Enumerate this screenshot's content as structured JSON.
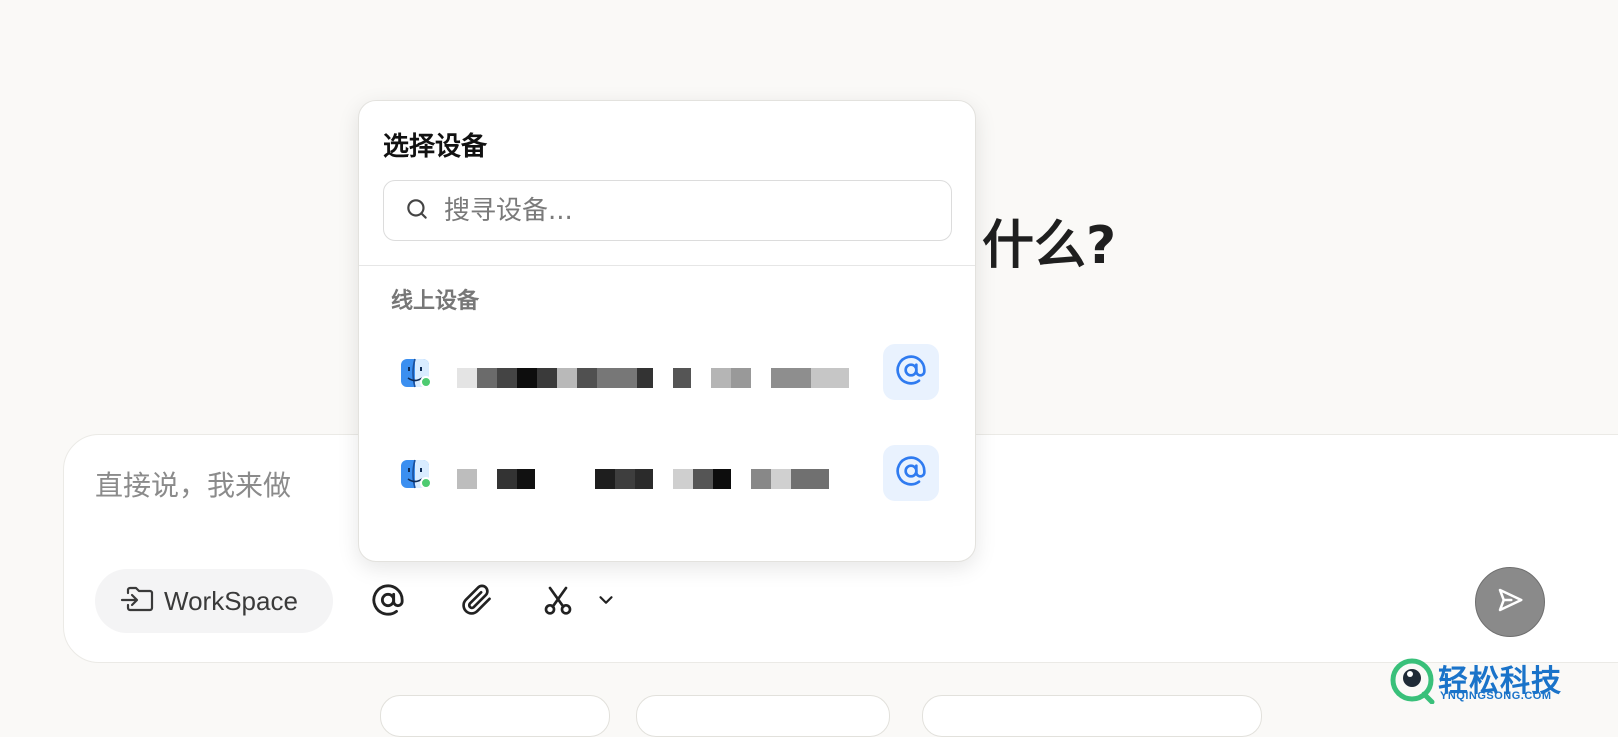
{
  "hero": {
    "title_visible": "什么?"
  },
  "composer": {
    "placeholder": "直接说，我来做",
    "workspace_label": "WorkSpace"
  },
  "device_picker": {
    "title": "选择设备",
    "search_placeholder": "搜寻设备...",
    "section_label": "线上设备",
    "devices": [
      {
        "name": "",
        "status": "online",
        "icon": "finder-icon"
      },
      {
        "name": "",
        "status": "online",
        "icon": "finder-icon"
      }
    ]
  },
  "watermark": {
    "text": "轻松科技",
    "subtext": "YNQINGSONG.COM"
  },
  "colors": {
    "background": "#faf9f7",
    "accent_blue": "#2f7bf0",
    "online_green": "#4ecb71",
    "send_button": "#8a8a8a"
  }
}
